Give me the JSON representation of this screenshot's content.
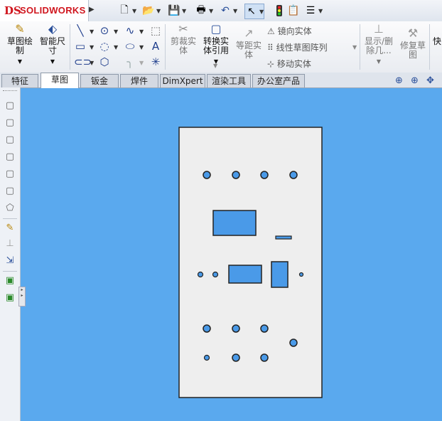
{
  "app": {
    "logo_text": "SOLIDWORKS",
    "logo_mark": "DS"
  },
  "ribbon": {
    "sketch_label": "草图绘制",
    "smart_dim_label": "智能尺寸",
    "trim_label": "剪裁实体",
    "convert_label": "转换实体引用",
    "offset_label": "等距实体",
    "mirror_label": "镜向实体",
    "linear_pattern_label": "线性草图阵列",
    "move_label": "移动实体",
    "show_delete_label": "显示/删除几...",
    "repair_label": "修复草图",
    "quick_label": "快"
  },
  "tabs": [
    {
      "label": "特征"
    },
    {
      "label": "草图"
    },
    {
      "label": "钣金"
    },
    {
      "label": "焊件"
    },
    {
      "label": "DimXpert"
    },
    {
      "label": "渲染工具"
    },
    {
      "label": "办公室产品"
    }
  ],
  "colors": {
    "background": "#5aa9ee",
    "sheet": "#eeeeee",
    "hole": "#4a9ae8",
    "outline": "#222222"
  },
  "icons": [
    "new-icon",
    "open-icon",
    "save-icon",
    "print-icon",
    "undo-icon",
    "select-icon",
    "traffic-light-icon",
    "file-properties-icon",
    "options-icon",
    "zoom-fit-icon",
    "zoom-area-icon",
    "view-orient-icon"
  ]
}
